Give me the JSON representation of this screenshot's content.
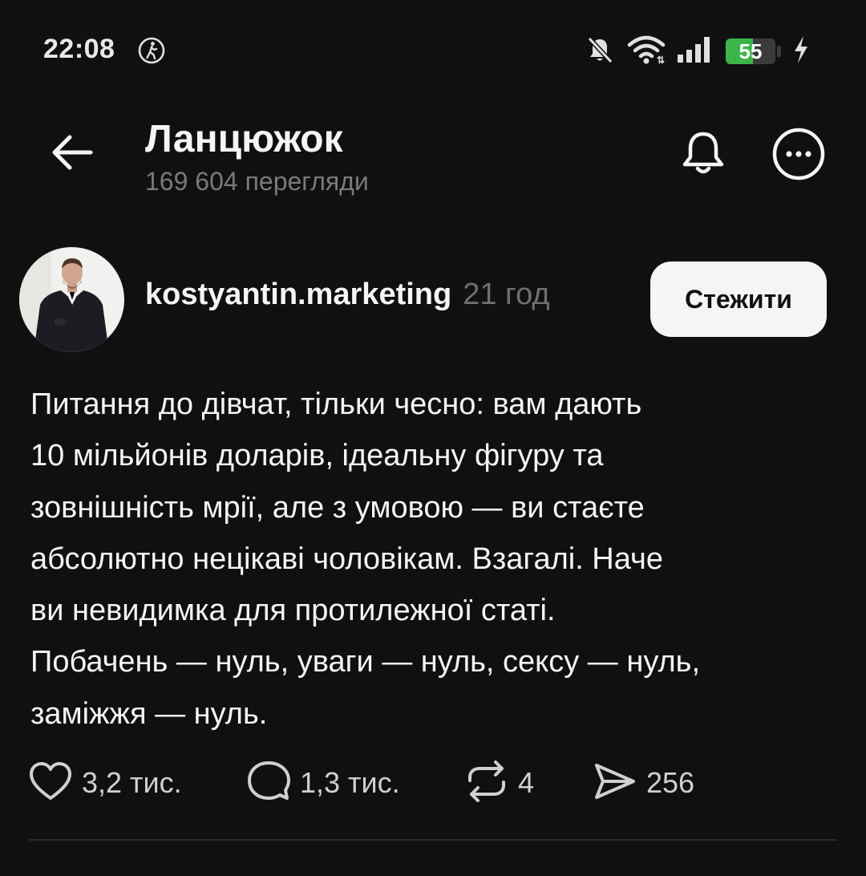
{
  "status_bar": {
    "time": "22:08",
    "battery_level": 55,
    "battery_text": "55",
    "icons": [
      "walking-figure-icon",
      "mute-bell-icon",
      "wifi-icon",
      "cellular-signal-icon",
      "battery-icon",
      "charging-bolt-icon"
    ]
  },
  "header": {
    "title": "Ланцюжок",
    "subtitle": "169 604 перегляди",
    "icons": [
      "back-arrow-icon",
      "bell-icon",
      "more-icon"
    ]
  },
  "post": {
    "author": "kostyantin.marketing",
    "time": "21 год",
    "follow_label": "Стежити",
    "text": "Питання до дівчат, тільки чесно: вам дають 10 мільйонів доларів, ідеальну фігуру та зовнішність мрії, але з умовою — ви стаєте абсолютно нецікаві чоловікам. Взагалі. Наче ви невидимка для протилежної статі. Побачень — нуль, уваги — нуль, сексу — нуль, заміжжя — нуль.",
    "lines": [
      "Питання до дівчат, тільки чесно: вам дають",
      "10 мільйонів доларів, ідеальну фігуру та",
      "зовнішність мрії, але з умовою — ви стаєте",
      "абсолютно нецікаві чоловікам. Взагалі. Наче",
      "ви невидимка для протилежної статі.",
      "Побачень — нуль, уваги — нуль, сексу — нуль,",
      "заміжжя — нуль."
    ],
    "actions": {
      "likes": "3,2 тис.",
      "comments": "1,3 тис.",
      "reposts": "4",
      "shares": "256"
    }
  },
  "colors": {
    "background": "#101010",
    "text_primary": "#f3f5f7",
    "text_secondary": "#7a7a7a",
    "battery_green": "#3bb54a",
    "button_bg": "#f3f5f7"
  }
}
